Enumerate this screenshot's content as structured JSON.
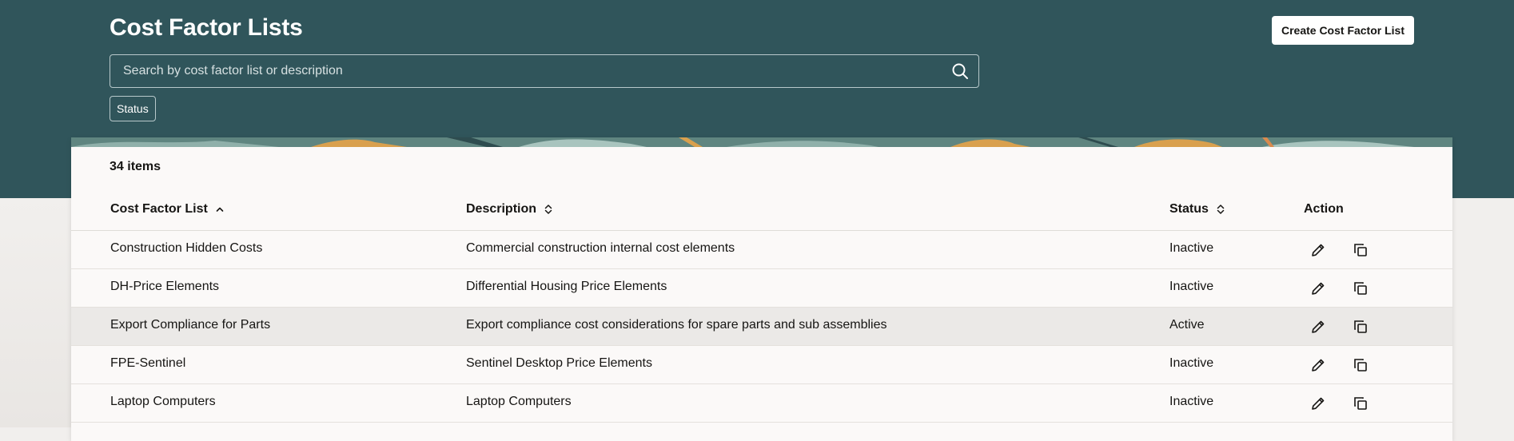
{
  "header": {
    "title": "Cost Factor Lists",
    "create_button_label": "Create Cost Factor List",
    "search": {
      "placeholder": "Search by cost factor list or description",
      "value": ""
    },
    "filter_chip_label": "Status"
  },
  "table": {
    "item_count": "34 items",
    "columns": [
      {
        "label": "Cost Factor List",
        "sort": "ascending"
      },
      {
        "label": "Description",
        "sort": "sortable"
      },
      {
        "label": "Status",
        "sort": "sortable"
      },
      {
        "label": "Action"
      }
    ],
    "rows": [
      {
        "name": "Construction Hidden Costs",
        "description": "Commercial construction internal cost elements",
        "status": "Inactive",
        "selected": false
      },
      {
        "name": "DH-Price Elements",
        "description": "Differential Housing Price Elements",
        "status": "Inactive",
        "selected": false
      },
      {
        "name": "Export Compliance for Parts",
        "description": "Export compliance cost considerations for spare parts and sub assemblies",
        "status": "Active",
        "selected": true
      },
      {
        "name": "FPE-Sentinel",
        "description": "Sentinel Desktop Price Elements",
        "status": "Inactive",
        "selected": false
      },
      {
        "name": "Laptop Computers",
        "description": "Laptop Computers",
        "status": "Inactive",
        "selected": false
      }
    ],
    "row_actions": [
      "edit-icon",
      "duplicate-icon"
    ]
  },
  "colors": {
    "header_background": "#30555b",
    "page_background": "#f1efed",
    "card_background": "#fbf9f8",
    "selected_row": "#ebe9e7",
    "text": "#161513"
  }
}
